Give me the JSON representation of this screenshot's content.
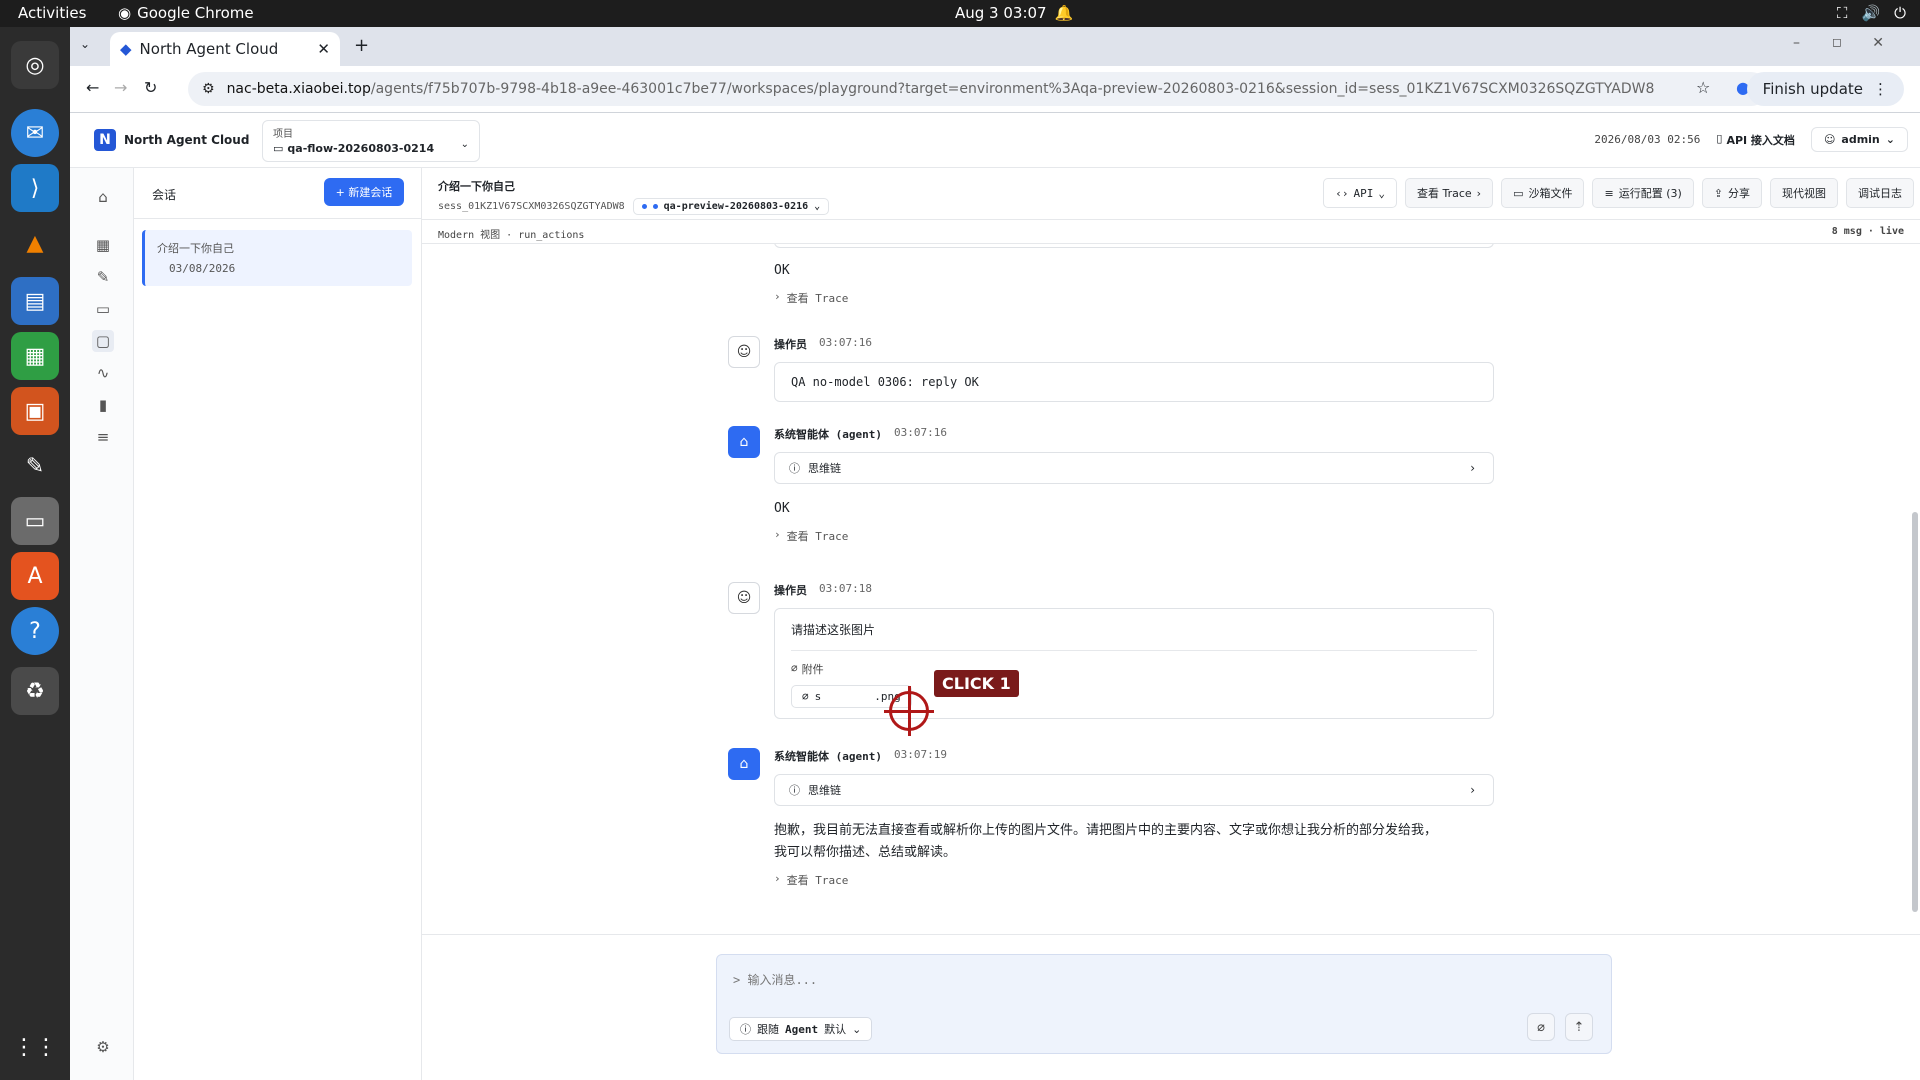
{
  "os": {
    "activities": "Activities",
    "app": "Google Chrome",
    "clock": "Aug 3  03:07"
  },
  "browser": {
    "tab_title": "North Agent Cloud",
    "url_host": "nac-beta.xiaobei.top",
    "url_path": "/agents/f75b707b-9798-4b18-a9ee-463001c7be77/workspaces/playground?target=environment%3Aqa-preview-20260803-0216&session_id=sess_01KZ1V67SCXM0326SQZGTYADW8",
    "finish_update": "Finish update"
  },
  "header": {
    "brand": "North Agent Cloud",
    "project_label": "项目",
    "project_value": "qa-flow-20260803-0214",
    "datetime": "2026/08/03 02:56",
    "api_docs": "API 接入文档",
    "user": "admin"
  },
  "sessions": {
    "title": "会话",
    "new_button": "+ 新建会话",
    "items": [
      {
        "title": "介绍一下你自己",
        "date": "03/08/2026"
      }
    ]
  },
  "main": {
    "title": "介绍一下你自己",
    "session_id": "sess_01KZ1V67SCXM0326SQZGTYADW8",
    "environment": "qa-preview-20260803-0216",
    "buttons": {
      "api": "API",
      "trace": "查看 Trace",
      "sandbox": "沙箱文件",
      "run_config": "运行配置 (3)",
      "share": "分享",
      "modern_view": "现代视图",
      "debug_log": "调试日志"
    },
    "sub_left": "Modern 视图 · run_actions",
    "sub_right": "8 msg · live"
  },
  "messages": {
    "m0": {
      "reply": "OK",
      "trace": "查看 Trace"
    },
    "m1": {
      "role": "操作员",
      "time": "03:07:16",
      "text": "QA no-model 0306: reply OK"
    },
    "m2": {
      "role": "系统智能体 (agent)",
      "time": "03:07:16",
      "think": "思维链",
      "reply": "OK",
      "trace": "查看 Trace"
    },
    "m3": {
      "role": "操作员",
      "time": "03:07:18",
      "text": "请描述这张图片",
      "attach_label": "附件",
      "file": "s        .png"
    },
    "m4": {
      "role": "系统智能体 (agent)",
      "time": "03:07:19",
      "think": "思维链",
      "reply1": "抱歉，我目前无法直接查看或解析你上传的图片文件。请把图片中的主要内容、文字或你想让我分析的部分发给我，",
      "reply2": "我可以帮你描述、总结或解读。",
      "trace": "查看 Trace"
    }
  },
  "composer": {
    "placeholder": "> 输入消息...",
    "agent_follow": "跟随",
    "agent_word": "Agent",
    "agent_default": "默认"
  },
  "overlay": {
    "click_label": "CLICK 1"
  }
}
